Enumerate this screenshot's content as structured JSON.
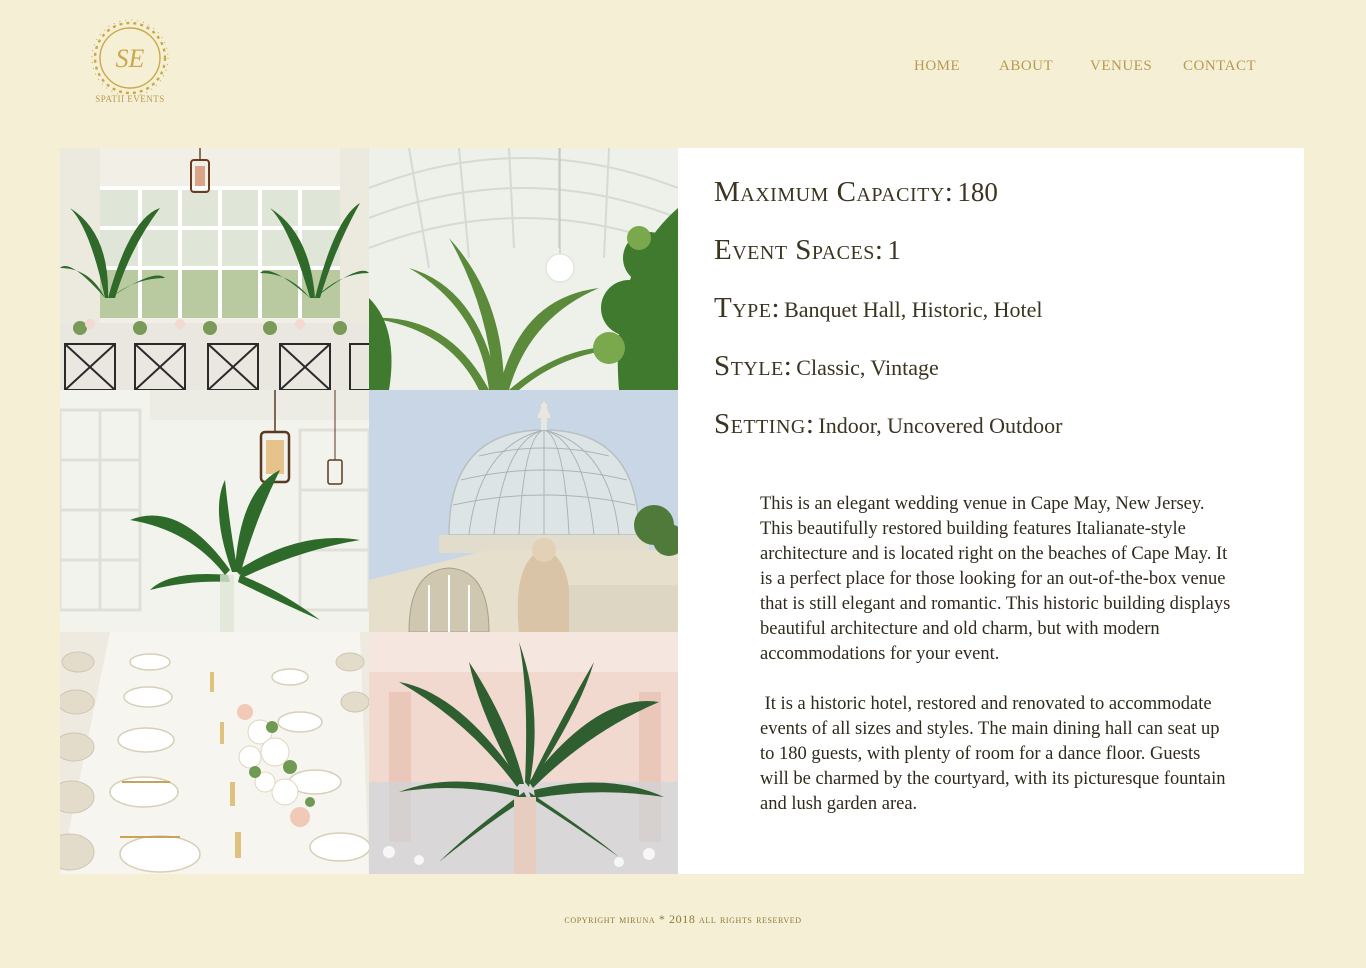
{
  "brand": {
    "monogram": "SE",
    "name": "SPATII EVENTS"
  },
  "nav": {
    "items": [
      "HOME",
      "ABOUT",
      "VENUES",
      "CONTACT"
    ]
  },
  "gallery": {
    "photos": [
      "tropical-banquet-photo",
      "palm-conservatory-photo",
      "hanging-lantern-photo",
      "glass-dome-photo",
      "table-setting-photo",
      "palm-centerpiece-photo"
    ]
  },
  "venue": {
    "capacity_label": "Maximum Capacity:",
    "capacity_value": "180",
    "spaces_label": "Event Spaces:",
    "spaces_value": "1",
    "type_label": "Type:",
    "type_value": "Banquet Hall, Historic, Hotel",
    "style_label": "Style:",
    "style_value": "Classic, Vintage",
    "setting_label": "Setting:",
    "setting_value": "Indoor, Uncovered Outdoor",
    "description_1": "This is an elegant wedding venue in Cape May, New Jersey. This beautifully restored building features Italianate-style architecture and is located right on the beaches of Cape May. It is a perfect place for those looking for an out-of-the-box venue that is still elegant and romantic. This historic building displays beautiful architecture and old charm, but with modern accommodations for your event.",
    "description_2": " It is a historic hotel, restored and renovated to accommodate events of all sizes and styles. The main dining hall can seat up to 180 guests, with plenty of room for a dance floor. Guests will be charmed by the courtyard, with its picturesque fountain and lush garden area."
  },
  "footer": {
    "copyright": "copyright miruna * 2018 all rights reserved"
  },
  "colors": {
    "background": "#f5f0d5",
    "gold": "#b89a4f",
    "text": "#3a3420",
    "panel": "#ffffff"
  }
}
